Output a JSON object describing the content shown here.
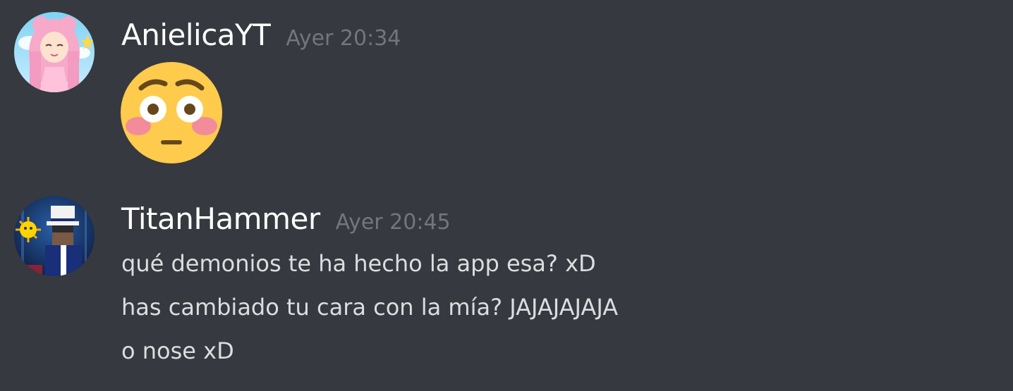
{
  "messages": [
    {
      "author": "AnielicaYT",
      "timestamp": "Ayer 20:34",
      "content_emoji": "flushed-face-emoji",
      "lines": []
    },
    {
      "author": "TitanHammer",
      "timestamp": "Ayer 20:45",
      "lines": [
        "qué demonios te ha hecho la app esa? xD",
        "has cambiado tu cara con la mía? JAJAJAJAJA",
        "o nose xD"
      ]
    }
  ],
  "colors": {
    "background": "#36393f",
    "username": "#ffffff",
    "timestamp": "#72767d",
    "message_text": "#dcddde"
  }
}
